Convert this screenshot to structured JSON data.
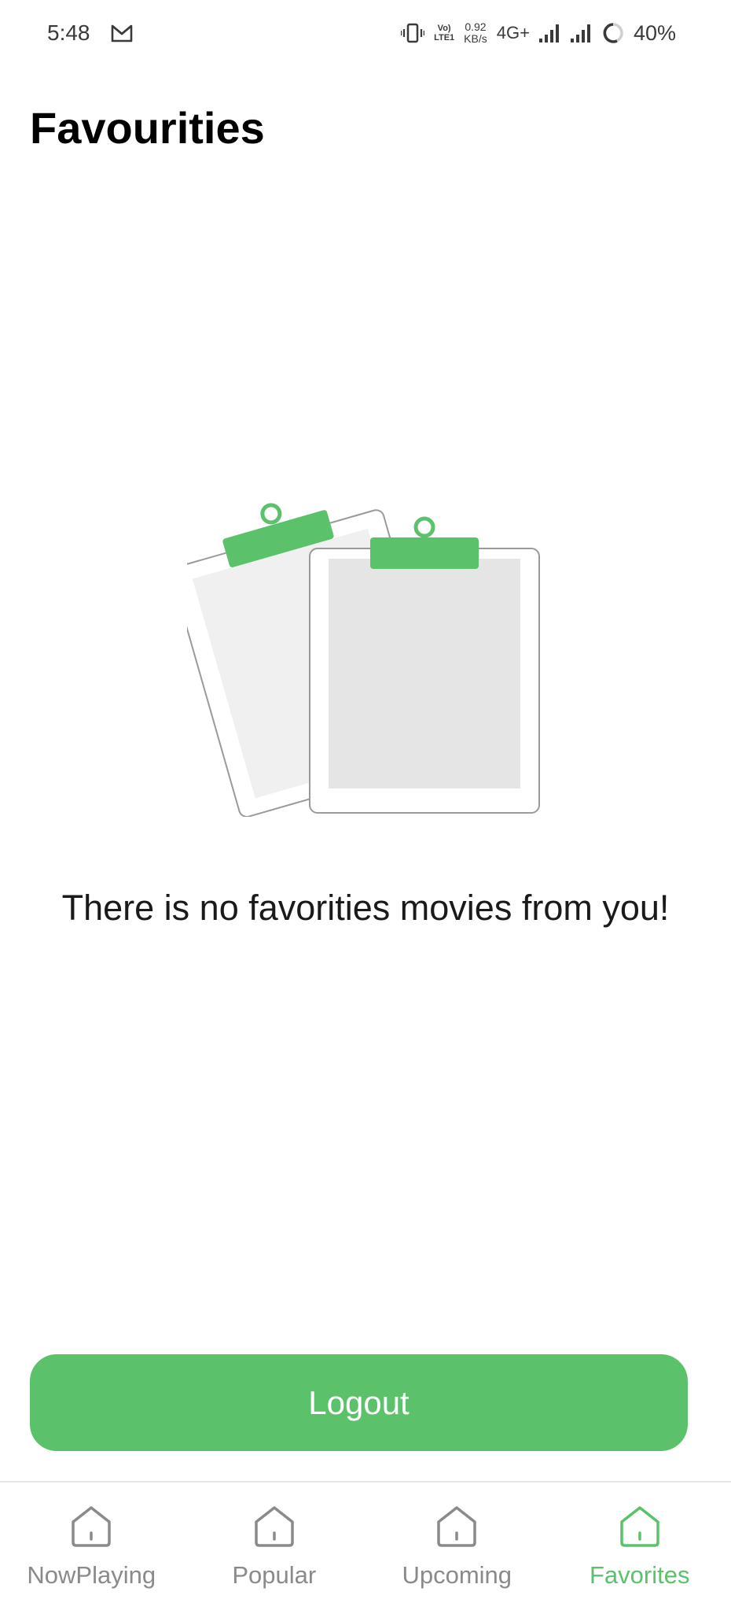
{
  "status_bar": {
    "time": "5:48",
    "volte_top": "Vo)",
    "volte_bottom": "LTE1",
    "speed_value": "0.92",
    "speed_unit": "KB/s",
    "network": "4G+",
    "battery": "40%"
  },
  "page": {
    "title": "Favourities",
    "empty_message": "There is no favorities movies from you!",
    "illustration_icon": "clipboard-icon"
  },
  "logout": {
    "label": "Logout"
  },
  "bottom_nav": {
    "items": [
      {
        "label": "NowPlaying",
        "icon": "home-icon",
        "active": false
      },
      {
        "label": "Popular",
        "icon": "home-icon",
        "active": false
      },
      {
        "label": "Upcoming",
        "icon": "home-icon",
        "active": false
      },
      {
        "label": "Favorites",
        "icon": "home-icon",
        "active": true
      }
    ]
  },
  "colors": {
    "accent": "#5bc26b",
    "inactive": "#8a8a8a"
  }
}
